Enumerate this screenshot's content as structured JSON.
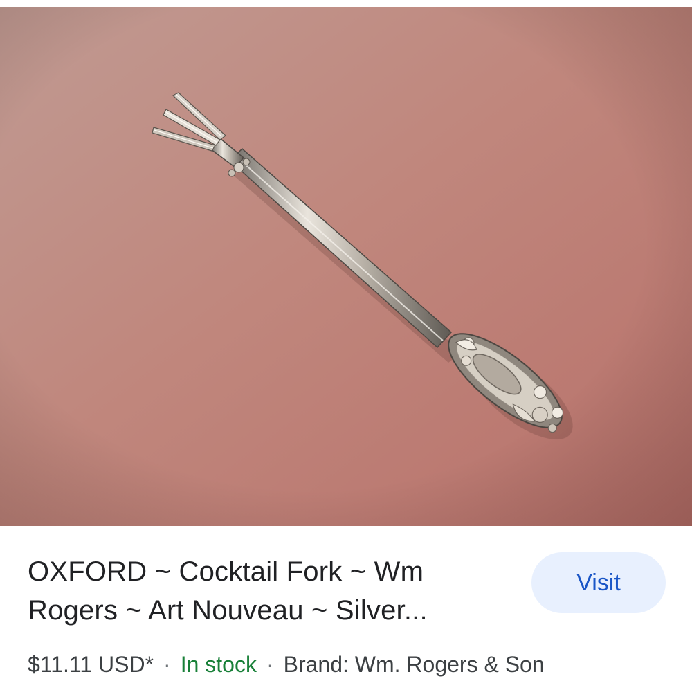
{
  "product": {
    "title": "OXFORD ~ Cocktail Fork ~ Wm Rogers ~ Art Nouveau ~ Silver...",
    "image_alt": "Silver cocktail fork with ornate Art Nouveau handle on a pink background",
    "visit_label": "Visit",
    "price": "$11.11 USD*",
    "separator": "·",
    "stock_status": "In stock",
    "brand": "Brand: Wm. Rogers & Son"
  },
  "colors": {
    "title_text": "#202124",
    "visit_bg": "#e8f0fe",
    "visit_text": "#1a56c7",
    "stock_text": "#188038",
    "meta_text": "#3c4043"
  }
}
